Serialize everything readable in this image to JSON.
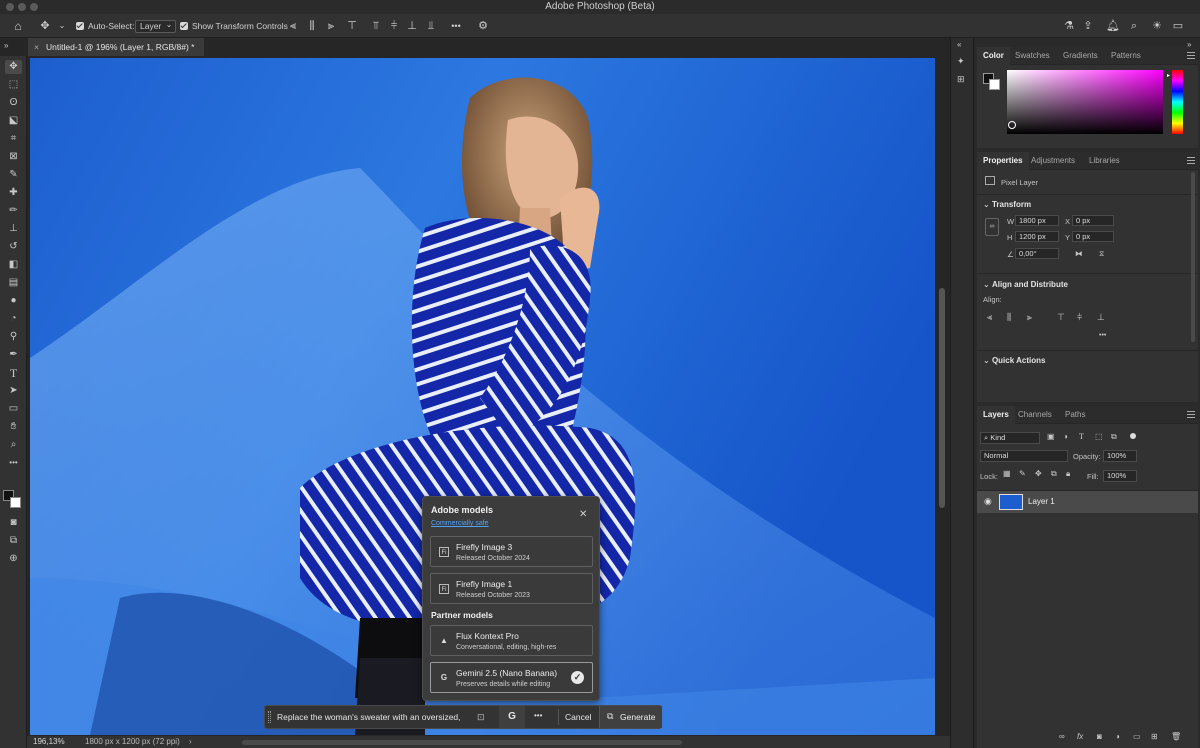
{
  "window": {
    "title": "Adobe Photoshop (Beta)"
  },
  "options_bar": {
    "auto_select_label": "Auto-Select:",
    "auto_select_value": "Layer",
    "show_transform_label": "Show Transform Controls",
    "more": "•••"
  },
  "document_tab": {
    "title": "Untitled-1 @ 196% (Layer 1, RGB/8#) *",
    "close": "×"
  },
  "status": {
    "zoom": "196,13%",
    "doc_info": "1800 px x 1200 px (72 ppi)",
    "arrow": "›"
  },
  "color_panel": {
    "tabs": [
      "Color",
      "Swatches",
      "Gradients",
      "Patterns"
    ],
    "hue_color": "#ff00ff"
  },
  "properties_panel": {
    "tabs": [
      "Properties",
      "Adjustments",
      "Libraries"
    ],
    "layer_kind": "Pixel Layer",
    "transform_title": "Transform",
    "w_label": "W",
    "w_value": "1800 px",
    "h_label": "H",
    "h_value": "1200 px",
    "x_label": "X",
    "x_value": "0 px",
    "y_label": "Y",
    "y_value": "0 px",
    "angle_value": "0,00°",
    "align_title": "Align and Distribute",
    "align_label": "Align:",
    "align_more": "•••",
    "quick_actions_title": "Quick Actions"
  },
  "layers_panel": {
    "tabs": [
      "Layers",
      "Channels",
      "Paths"
    ],
    "filter_kind": "Kind",
    "blend_mode": "Normal",
    "opacity_label": "Opacity:",
    "opacity_value": "100%",
    "lock_label": "Lock:",
    "fill_label": "Fill:",
    "fill_value": "100%",
    "layers": [
      {
        "name": "Layer 1",
        "visible": true
      }
    ]
  },
  "model_popup": {
    "adobe_section": "Adobe models",
    "commercially_safe": "Commercially safe",
    "close": "✕",
    "adobe_models": [
      {
        "name": "Firefly Image 3",
        "detail": "Released October 2024",
        "icon": "Fi"
      },
      {
        "name": "Firefly Image 1",
        "detail": "Released October 2023",
        "icon": "Fi"
      }
    ],
    "partner_section": "Partner models",
    "partner_models": [
      {
        "name": "Flux Kontext Pro",
        "detail": "Conversational, editing, high-res",
        "icon": "▲"
      },
      {
        "name": "Gemini 2.5 (Nano Banana)",
        "detail": "Preserves details while editing",
        "icon": "G",
        "selected": true
      }
    ]
  },
  "prompt_bar": {
    "prompt_text": "Replace the woman's sweater with an oversized,",
    "model_icon": "G",
    "more": "•••",
    "cancel": "Cancel",
    "generate": "Generate"
  }
}
